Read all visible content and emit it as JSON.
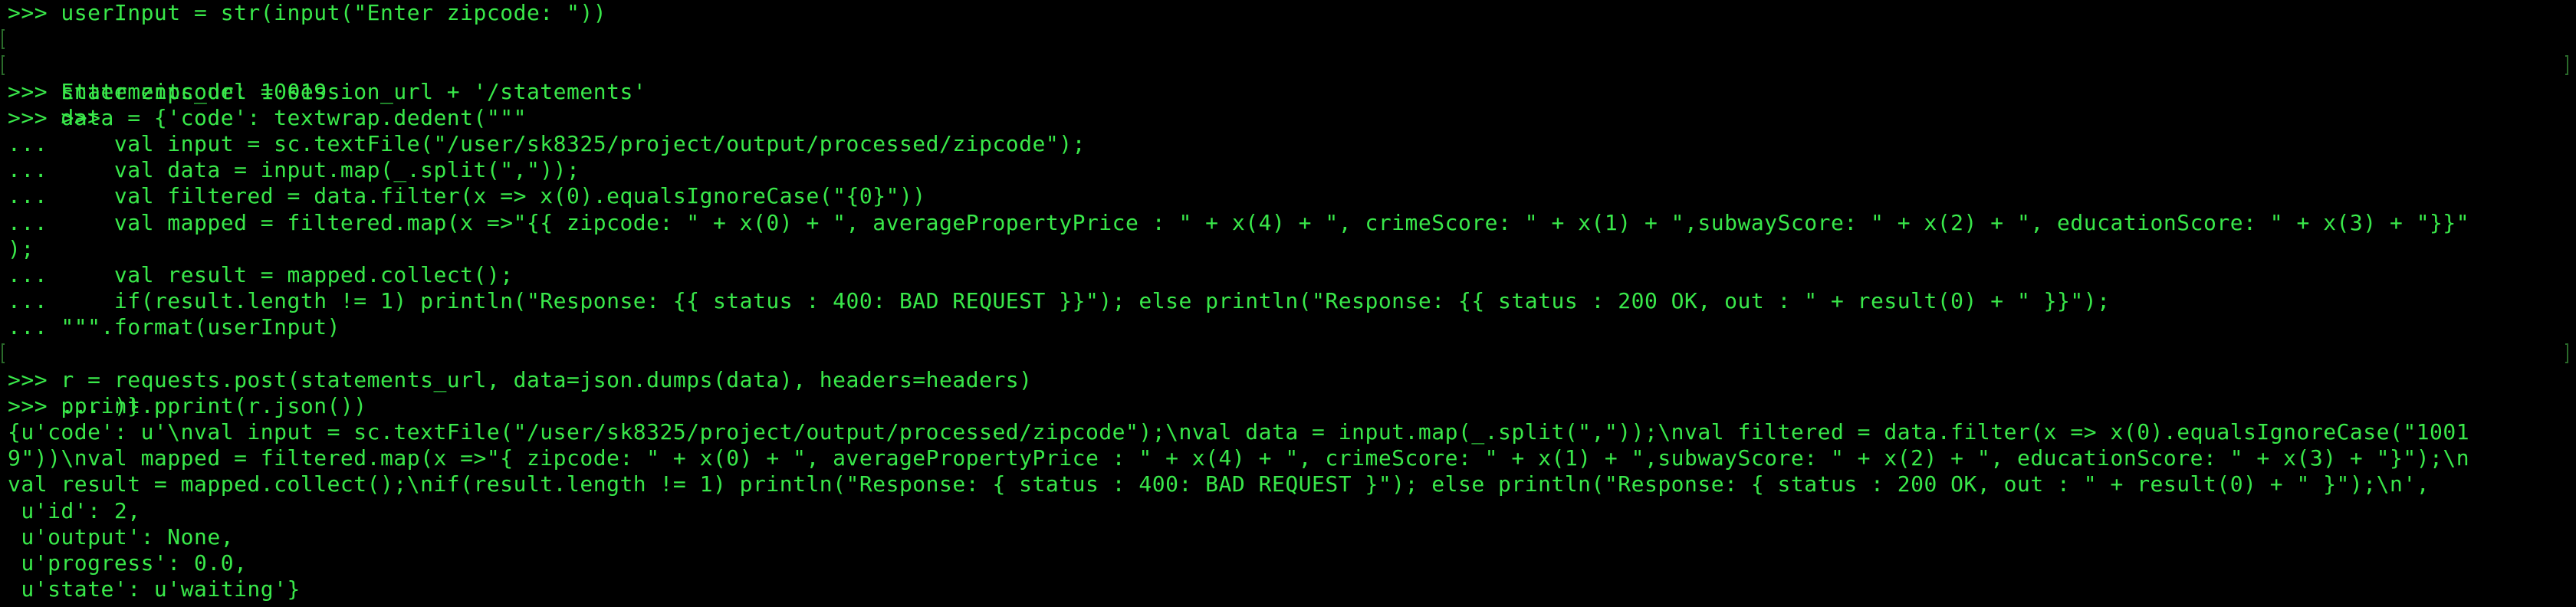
{
  "terminal": {
    "lines": [
      ">>> userInput = str(input(\"Enter zipcode: \"))",
      "Enter zipcode: 10019",
      ">>>",
      ">>> statements_url = session_url + '/statements'",
      ">>> data = {'code': textwrap.dedent(\"\"\"",
      "...     val input = sc.textFile(\"/user/sk8325/project/output/processed/zipcode\");",
      "...     val data = input.map(_.split(\",\"));",
      "...     val filtered = data.filter(x => x(0).equalsIgnoreCase(\"{0}\"))",
      "...     val mapped = filtered.map(x =>\"{{ zipcode: \" + x(0) + \", averagePropertyPrice : \" + x(4) + \", crimeScore: \" + x(1) + \",subwayScore: \" + x(2) + \", educationScore: \" + x(3) + \"}}\"",
      ");",
      "...     val result = mapped.collect();",
      "...     if(result.length != 1) println(\"Response: {{ status : 400: BAD REQUEST }}\"); else println(\"Response: {{ status : 200 OK, out : \" + result(0) + \" }}\");",
      "... \"\"\".format(userInput)",
      "... )}",
      ">>> r = requests.post(statements_url, data=json.dumps(data), headers=headers)",
      ">>> pprint.pprint(r.json())",
      "{u'code': u'\\nval input = sc.textFile(\"/user/sk8325/project/output/processed/zipcode\");\\nval data = input.map(_.split(\",\"));\\nval filtered = data.filter(x => x(0).equalsIgnoreCase(\"1001",
      "9\"))\\nval mapped = filtered.map(x =>\"{ zipcode: \" + x(0) + \", averagePropertyPrice : \" + x(4) + \", crimeScore: \" + x(1) + \",subwayScore: \" + x(2) + \", educationScore: \" + x(3) + \"}\");\\n",
      "val result = mapped.collect();\\nif(result.length != 1) println(\"Response: { status : 400: BAD REQUEST }\"); else println(\"Response: { status : 200 OK, out : \" + result(0) + \" }\");\\n',",
      " u'id': 2,",
      " u'output': None,",
      " u'progress': 0.0,",
      " u'state': u'waiting'}"
    ]
  },
  "colors": {
    "background": "#000000",
    "text": "#39e84a",
    "bracket": "#2a6a2a"
  }
}
